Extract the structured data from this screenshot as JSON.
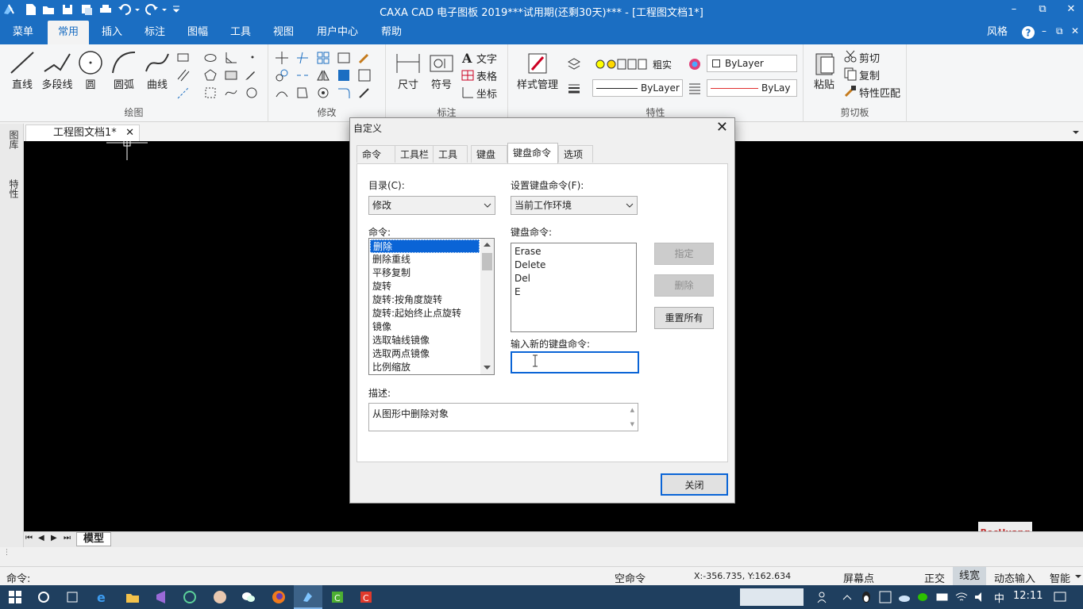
{
  "window": {
    "title": "CAXA CAD 电子图板 2019***试用期(还剩30天)*** - [工程图文档1*]",
    "min": "–",
    "restore": "⧉",
    "close": "✕"
  },
  "ribbon_tabs": [
    "菜单",
    "常用",
    "插入",
    "标注",
    "图幅",
    "工具",
    "视图",
    "用户中心",
    "帮助"
  ],
  "style_label": "风格",
  "ribbon": {
    "draw": {
      "label": "绘图",
      "line": "直线",
      "polyline": "多段线",
      "circle": "圆",
      "arc": "圆弧",
      "curve": "曲线"
    },
    "modify": {
      "label": "修改"
    },
    "annotate": {
      "label": "标注",
      "dimension": "尺寸",
      "symbol": "符号",
      "text": "文字",
      "table": "表格",
      "coordinate": "坐标"
    },
    "properties": {
      "label": "特性",
      "style_manage": "样式管理",
      "layer": "粗实",
      "color_combo": "ByLayer",
      "linetype_combo": "ByLayer",
      "lineweight_combo": "ByLay"
    },
    "clipboard": {
      "label": "剪切板",
      "paste": "粘贴",
      "cut": "剪切",
      "copy": "复制",
      "match": "特性匹配"
    }
  },
  "document": {
    "tab": "工程图文档1*",
    "close": "✕",
    "model_tab": "模型"
  },
  "left_panels": [
    "图库",
    "特性"
  ],
  "dialog": {
    "title": "自定义",
    "close": "✕",
    "tabs": [
      "命令",
      "工具栏",
      "工具",
      "键盘",
      "键盘命令",
      "选项"
    ],
    "active_tab": "键盘命令",
    "category_label": "目录(C):",
    "category_value": "修改",
    "set_label": "设置键盘命令(F):",
    "set_value": "当前工作环境",
    "commands_label": "命令:",
    "commands": [
      "删除",
      "删除重线",
      "平移复制",
      "旋转",
      "旋转:按角度旋转",
      "旋转:起始终止点旋转",
      "镜像",
      "选取轴线镜像",
      "选取两点镜像",
      "比例缩放"
    ],
    "selected_command": "删除",
    "keys_label": "键盘命令:",
    "keys": [
      "Erase",
      "Delete",
      "Del",
      "E"
    ],
    "assign_btn": "指定",
    "delete_btn": "删除",
    "reset_btn": "重置所有",
    "new_key_label": "输入新的键盘命令:",
    "new_key_value": "",
    "desc_label": "描述:",
    "desc_value": "从图形中删除对象",
    "close_btn": "关闭"
  },
  "watermark": "RocHuang",
  "status": {
    "cmd_prompt": "命令:",
    "empty_cmd": "空命令",
    "coords": "X:-356.735, Y:162.634",
    "screen_point": "屏幕点",
    "ortho": "正交",
    "lineweight": "线宽",
    "dynamic_input": "动态输入",
    "smart": "智能"
  },
  "taskbar": {
    "ime": "中",
    "time": "12:11"
  }
}
